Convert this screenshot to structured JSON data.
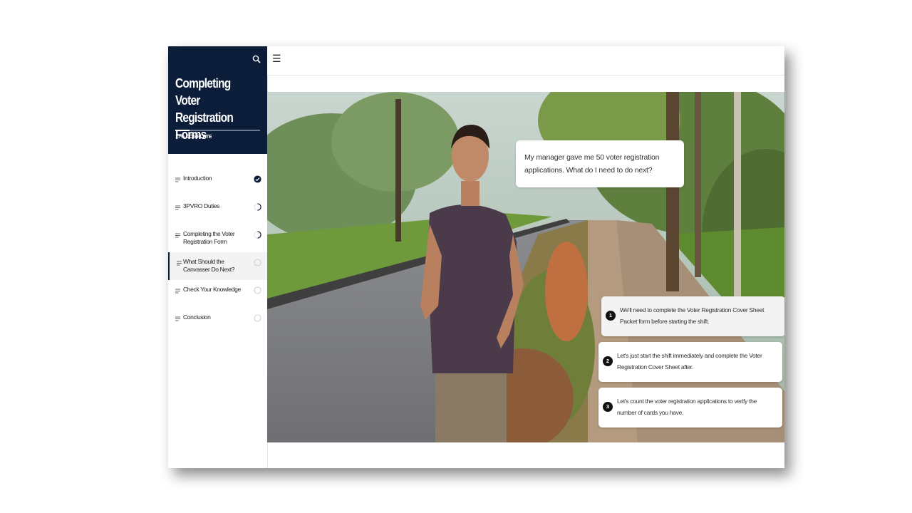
{
  "course": {
    "title": "Completing Voter Registration Forms",
    "progress_percent": 17,
    "progress_label": "17% COMPLETE"
  },
  "lessons": [
    {
      "label": "Introduction",
      "status": "complete"
    },
    {
      "label": "3PVRO Duties",
      "status": "in-progress"
    },
    {
      "label": "Completing the Voter Registration Form",
      "status": "in-progress"
    },
    {
      "label": "What Should the Canvasser Do Next?",
      "status": "not-started",
      "active": true
    },
    {
      "label": "Check Your Knowledge",
      "status": "not-started"
    },
    {
      "label": "Conclusion",
      "status": "not-started"
    }
  ],
  "topbar": {
    "menu_icon": "hamburger-icon",
    "menu_glyph": "☰"
  },
  "scene": {
    "speech": "My manager gave me 50 voter registration applications. What do I need to do next?",
    "choices": [
      {
        "number": "1",
        "text": "We'll need to complete the Voter Registration Cover Sheet Packet form before starting the shift."
      },
      {
        "number": "2",
        "text": "Let's just start the shift immediately and complete the Voter Registration Cover Sheet after."
      },
      {
        "number": "3",
        "text": "Let's count the voter registration applications to verify the number of cards you have."
      }
    ]
  },
  "colors": {
    "sidebar_header": "#0c1d3a",
    "accent": "#0c1d3a"
  }
}
